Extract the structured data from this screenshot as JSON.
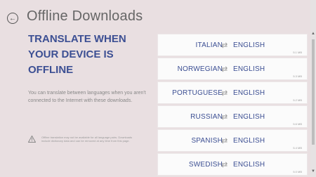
{
  "header": {
    "back_icon": "back-arrow-icon",
    "title": "Offline Downloads"
  },
  "left": {
    "headline": "TRANSLATE WHEN YOUR DEVICE IS OFFLINE",
    "description": "You can translate between languages when you aren't connected to the Internet with these downloads.",
    "notice_icon": "warning-icon",
    "notice": "Offline translation may not be available for all language pairs. Downloads include dictionary data and can be removed at any time from this page."
  },
  "downloads": [
    {
      "source": "ITALIAN",
      "target": "ENGLISH",
      "size": "5.1 MB"
    },
    {
      "source": "NORWEGIAN",
      "target": "ENGLISH",
      "size": "5.3 MB"
    },
    {
      "source": "PORTUGUESE",
      "target": "ENGLISH",
      "size": "5.2 MB"
    },
    {
      "source": "RUSSIAN",
      "target": "ENGLISH",
      "size": "5.6 MB"
    },
    {
      "source": "SPANISH",
      "target": "ENGLISH",
      "size": "5.4 MB"
    },
    {
      "source": "SWEDISH",
      "target": "ENGLISH",
      "size": "5.0 MB"
    }
  ],
  "colors": {
    "background": "#e9dfe1",
    "accent": "#3c4f93",
    "card": "#fbfbfb"
  }
}
